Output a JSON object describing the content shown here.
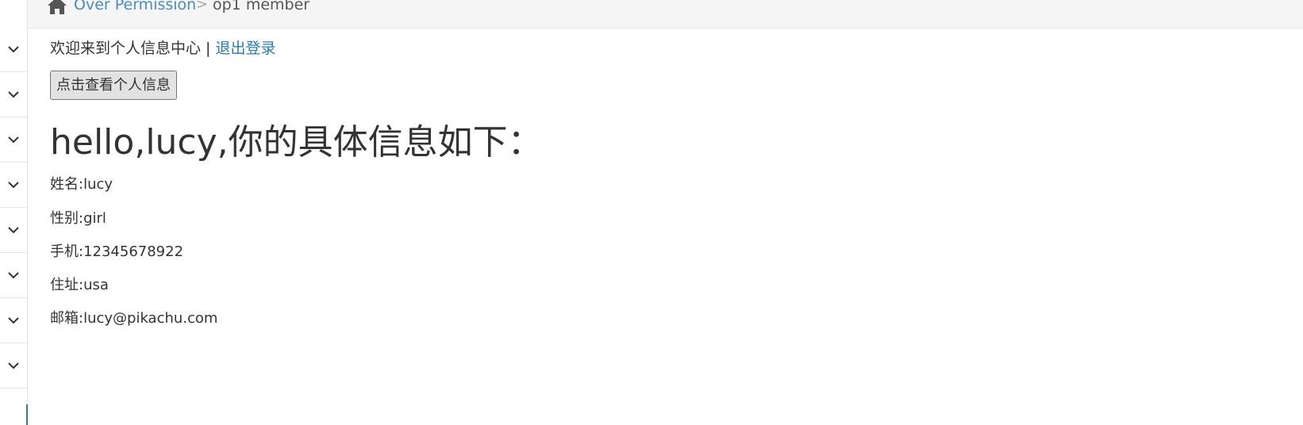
{
  "breadcrumb": {
    "home_icon": "home-icon",
    "parent": "Over Permission",
    "separator": ">",
    "current": "op1 member"
  },
  "sidebar": {
    "items": [
      {
        "icon": "chevron-down-icon"
      },
      {
        "icon": "chevron-down-icon"
      },
      {
        "icon": "chevron-down-icon"
      },
      {
        "icon": "chevron-down-icon"
      },
      {
        "icon": "chevron-down-icon"
      },
      {
        "icon": "chevron-down-icon"
      },
      {
        "icon": "chevron-down-icon"
      },
      {
        "icon": "chevron-down-icon"
      }
    ]
  },
  "welcome": {
    "text": "欢迎来到个人信息中心",
    "separator": " | ",
    "logout": "退出登录"
  },
  "view_button": "点击查看个人信息",
  "info": {
    "title": "hello,lucy,你的具体信息如下：",
    "name": "姓名:lucy",
    "gender": "性别:girl",
    "phone": "手机:12345678922",
    "address": "住址:usa",
    "email": "邮箱:lucy@pikachu.com"
  },
  "colors": {
    "link": "#2a7ab8",
    "breadcrumb_link": "#4a8bc2",
    "text": "#333333",
    "border": "#e5e5e5"
  }
}
